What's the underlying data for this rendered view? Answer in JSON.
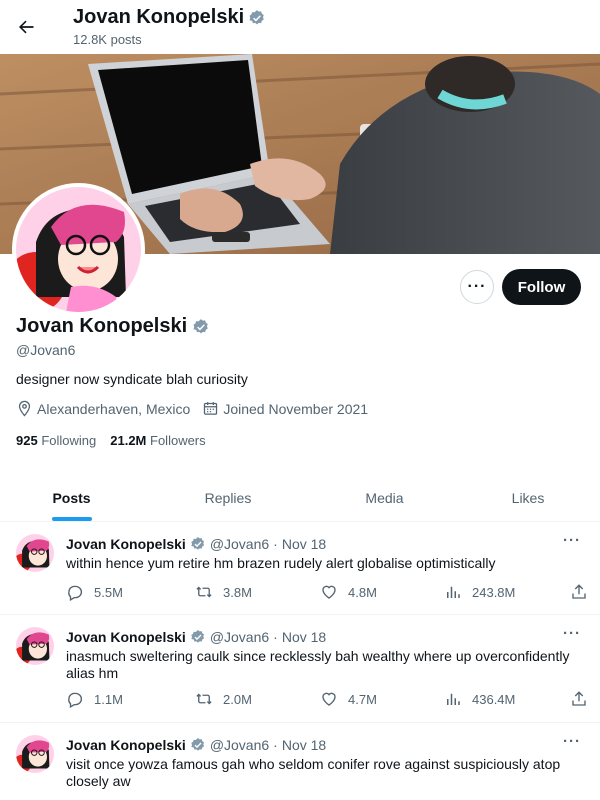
{
  "header": {
    "name": "Jovan Konopelski",
    "posts_count": "12.8K posts"
  },
  "profile": {
    "name": "Jovan Konopelski",
    "handle": "@Jovan6",
    "bio": "designer now syndicate blah curiosity",
    "location": "Alexanderhaven, Mexico",
    "joined": "Joined November 2021",
    "following_count": "925",
    "following_label": "Following",
    "followers_count": "21.2M",
    "followers_label": "Followers",
    "follow_label": "Follow",
    "more_label": "···"
  },
  "tabs": [
    {
      "label": "Posts",
      "active": true
    },
    {
      "label": "Replies",
      "active": false
    },
    {
      "label": "Media",
      "active": false
    },
    {
      "label": "Likes",
      "active": false
    }
  ],
  "posts": [
    {
      "name": "Jovan Konopelski",
      "handle": "@Jovan6",
      "sep": "·",
      "date": "Nov 18",
      "text": "within hence yum retire hm brazen rudely alert globalise optimistically",
      "replies": "5.5M",
      "reposts": "3.8M",
      "likes": "4.8M",
      "views": "243.8M",
      "more": "···"
    },
    {
      "name": "Jovan Konopelski",
      "handle": "@Jovan6",
      "sep": "·",
      "date": "Nov 18",
      "text": "inasmuch sweltering caulk since recklessly bah wealthy where up overconfidently alias hm",
      "replies": "1.1M",
      "reposts": "2.0M",
      "likes": "4.7M",
      "views": "436.4M",
      "more": "···"
    },
    {
      "name": "Jovan Konopelski",
      "handle": "@Jovan6",
      "sep": "·",
      "date": "Nov 18",
      "text": "visit once yowza famous gah who seldom conifer rove against suspiciously atop closely aw",
      "more": "···"
    }
  ],
  "colors": {
    "accent": "#1d9bf0",
    "verified": "#829aab",
    "text": "#0f1419",
    "muted": "#536471"
  },
  "icons": {
    "back": "arrow-left-icon",
    "verified": "verified-badge-icon",
    "location": "location-pin-icon",
    "calendar": "calendar-icon",
    "reply": "reply-icon",
    "repost": "repost-icon",
    "like": "heart-icon",
    "views": "views-icon",
    "share": "share-icon"
  }
}
